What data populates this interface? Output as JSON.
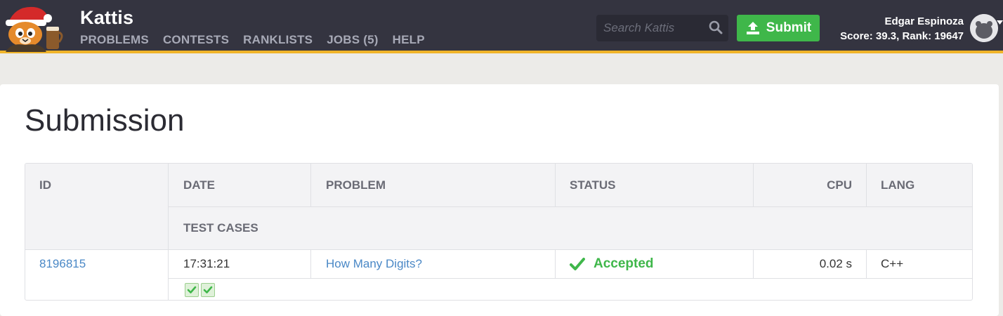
{
  "header": {
    "brand": "Kattis",
    "nav": [
      "PROBLEMS",
      "CONTESTS",
      "RANKLISTS",
      "JOBS (5)",
      "HELP"
    ],
    "search_placeholder": "Search Kattis",
    "submit_label": "Submit",
    "user_name": "Edgar Espinoza",
    "user_score": "Score: 39.3, Rank: 19647",
    "accent_color": "#f0b429",
    "bg_color": "#343440",
    "submit_color": "#3fb74a"
  },
  "page": {
    "title": "Submission"
  },
  "table": {
    "headers": {
      "id": "ID",
      "date": "DATE",
      "problem": "PROBLEM",
      "status": "STATUS",
      "cpu": "CPU",
      "lang": "LANG",
      "test_cases": "TEST CASES"
    },
    "row": {
      "id": "8196815",
      "date": "17:31:21",
      "problem": "How Many Digits?",
      "status": "Accepted",
      "cpu": "0.02 s",
      "lang": "C++",
      "test_cases": [
        "passed",
        "passed"
      ]
    }
  }
}
